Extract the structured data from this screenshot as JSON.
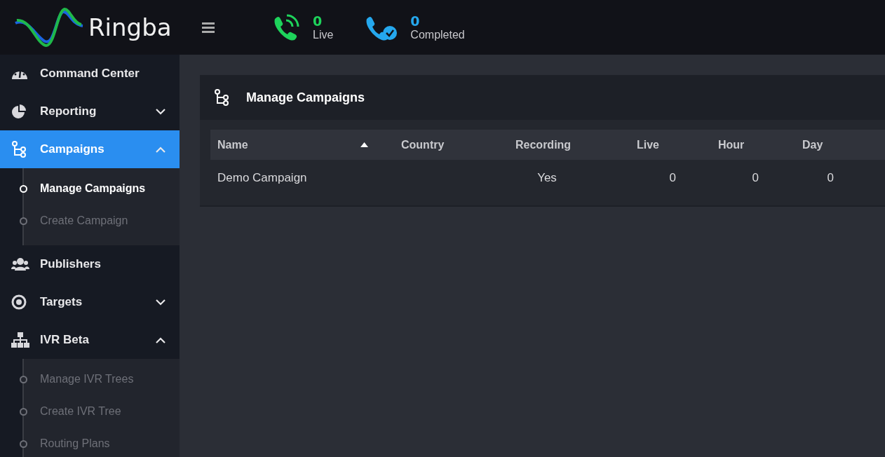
{
  "header": {
    "brand": "Ringba",
    "stats": [
      {
        "kind": "live",
        "count": "0",
        "label": "Live"
      },
      {
        "kind": "completed",
        "count": "0",
        "label": "Completed"
      }
    ]
  },
  "sidebar": {
    "items": [
      {
        "label": "Command Center",
        "selected": false
      },
      {
        "label": "Reporting",
        "expanded": false,
        "selected": false
      },
      {
        "label": "Campaigns",
        "expanded": true,
        "selected": true,
        "children": [
          {
            "label": "Manage Campaigns",
            "selected": true
          },
          {
            "label": "Create Campaign",
            "selected": false
          }
        ]
      },
      {
        "label": "Publishers",
        "selected": false
      },
      {
        "label": "Targets",
        "expanded": false,
        "selected": false
      },
      {
        "label": "IVR Beta",
        "expanded": true,
        "selected": false,
        "children": [
          {
            "label": "Manage IVR Trees",
            "selected": false
          },
          {
            "label": "Create IVR Tree",
            "selected": false
          },
          {
            "label": "Routing Plans",
            "selected": false
          }
        ]
      }
    ]
  },
  "panel": {
    "title": "Manage Campaigns",
    "table": {
      "columns": [
        {
          "label": "Name",
          "sorted": true
        },
        {
          "label": "Country",
          "sorted": false
        },
        {
          "label": "Recording",
          "sorted": false
        },
        {
          "label": "Live",
          "sorted": false
        },
        {
          "label": "Hour",
          "sorted": false
        },
        {
          "label": "Day",
          "sorted": false
        }
      ],
      "rows": [
        [
          "Demo Campaign",
          "",
          "Yes",
          "0",
          "0",
          "0"
        ]
      ]
    }
  }
}
